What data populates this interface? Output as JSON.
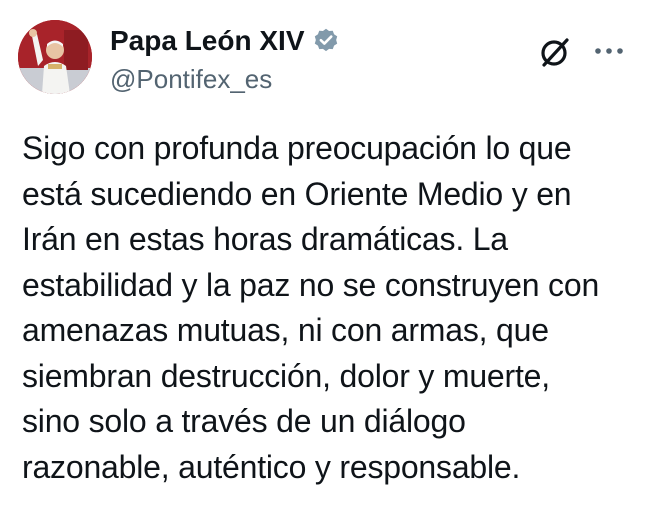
{
  "author": {
    "display_name": "Papa León XIV",
    "handle": "@Pontifex_es",
    "verified": true,
    "verified_color": "#829aab",
    "avatar_icon": "pope-portrait-avatar"
  },
  "header_icons": {
    "grok": "grok-icon",
    "more": "more-options-icon"
  },
  "tweet": {
    "lines": [
      "Sigo con profunda preocupación lo que",
      "está sucediendo en Oriente Medio y en",
      "Irán en estas horas dramáticas. La",
      "estabilidad y la paz no se construyen con",
      "amenazas mutuas, ni con armas, que",
      "siembran destrucción, dolor y muerte,",
      "sino solo a través de un diálogo",
      "razonable, auténtico y responsable."
    ]
  }
}
